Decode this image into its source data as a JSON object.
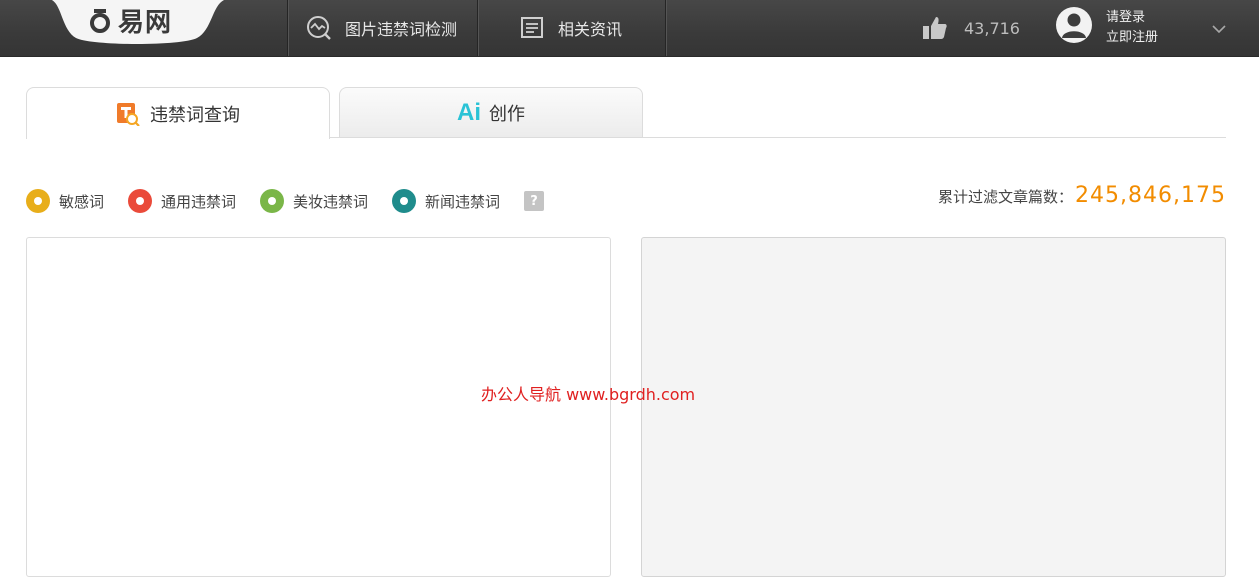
{
  "header": {
    "logo_text": "易网",
    "nav": [
      {
        "label": "图片违禁词检测",
        "icon": "image-check-icon"
      },
      {
        "label": "相关资讯",
        "icon": "news-icon"
      }
    ],
    "likes_count": "43,716",
    "login_label": "请登录",
    "register_label": "立即注册"
  },
  "tabs": [
    {
      "label": "违禁词查询",
      "icon": "search-doc-icon",
      "active": true
    },
    {
      "label": "创作",
      "icon": "ai-icon",
      "icon_text": "Ai",
      "active": false
    }
  ],
  "legend": [
    {
      "label": "敏感词",
      "color": "#e8ae1a"
    },
    {
      "label": "通用违禁词",
      "color": "#ea4a3a"
    },
    {
      "label": "美妆违禁词",
      "color": "#7ab648"
    },
    {
      "label": "新闻违禁词",
      "color": "#1f8c8c"
    }
  ],
  "help_label": "?",
  "counter": {
    "label": "累计过滤文章篇数：",
    "value": "245,846,175"
  },
  "watermark": "办公人导航 www.bgrdh.com"
}
